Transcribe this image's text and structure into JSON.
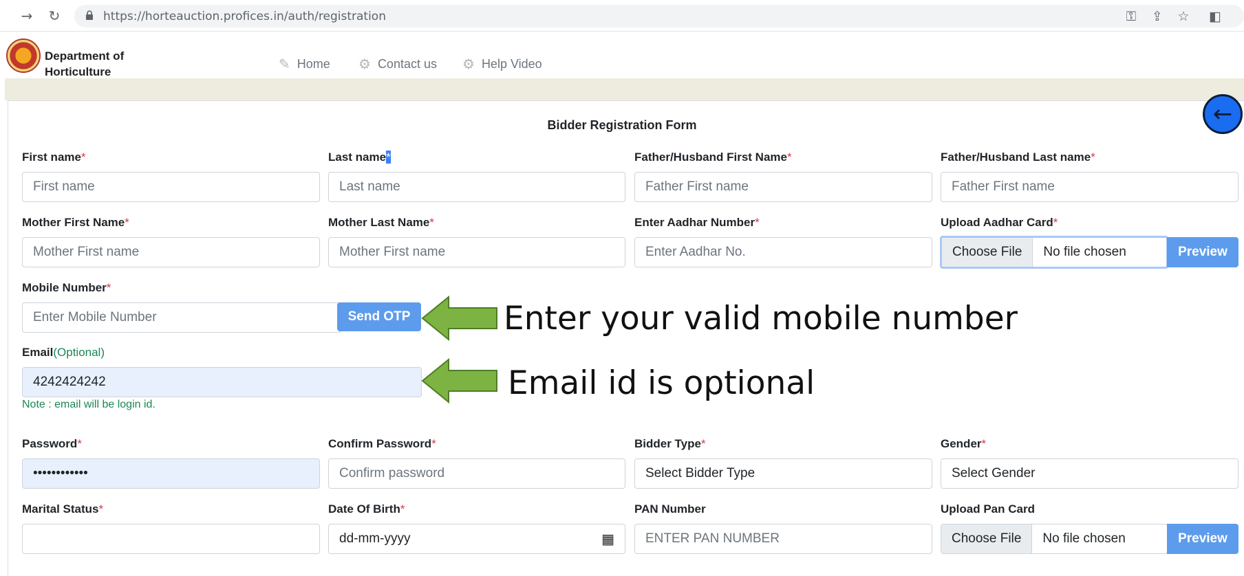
{
  "browser": {
    "url": "https://horteauction.profices.in/auth/registration",
    "icons": [
      "back-arrow",
      "forward-arrow",
      "reload",
      "lock",
      "key",
      "share",
      "star",
      "sidebar"
    ]
  },
  "header": {
    "brand": "Department of Horticulture",
    "nav": [
      {
        "label": "Home",
        "icon": "edit"
      },
      {
        "label": "Contact us",
        "icon": "gear"
      },
      {
        "label": "Help Video",
        "icon": "gear"
      }
    ]
  },
  "form": {
    "title": "Bidder Registration Form",
    "required_mark": "*",
    "first_name": {
      "label": "First name",
      "placeholder": "First name"
    },
    "last_name": {
      "label": "Last name",
      "placeholder": "Last name"
    },
    "father_first": {
      "label": "Father/Husband First Name",
      "placeholder": "Father First name"
    },
    "father_last": {
      "label": "Father/Husband Last name",
      "placeholder": "Father First name"
    },
    "mother_first": {
      "label": "Mother First Name",
      "placeholder": "Mother First name"
    },
    "mother_last": {
      "label": "Mother Last Name",
      "placeholder": "Mother First name"
    },
    "aadhar_no": {
      "label": "Enter Aadhar Number",
      "placeholder": "Enter Aadhar No."
    },
    "aadhar_card": {
      "label": "Upload Aadhar Card",
      "choose": "Choose File",
      "status": "No file chosen",
      "preview": "Preview"
    },
    "mobile": {
      "label": "Mobile Number",
      "placeholder": "Enter Mobile Number",
      "send_otp": "Send OTP"
    },
    "email": {
      "label": "Email",
      "optional": "(Optional)",
      "value": "4242424242",
      "note": "Note : email will be login id."
    },
    "password": {
      "label": "Password",
      "value": "••••••••••••"
    },
    "confirm_password": {
      "label": "Confirm Password",
      "placeholder": "Confirm password"
    },
    "bidder_type": {
      "label": "Bidder Type",
      "selected": "Select Bidder Type"
    },
    "gender": {
      "label": "Gender",
      "selected": "Select Gender"
    },
    "marital_status": {
      "label": "Marital Status",
      "selected": ""
    },
    "dob": {
      "label": "Date Of Birth",
      "placeholder": "dd-mm-yyyy"
    },
    "pan_number": {
      "label": "PAN Number",
      "placeholder": "ENTER PAN NUMBER"
    },
    "pan_card": {
      "label": "Upload Pan Card",
      "choose": "Choose File",
      "status": "No file chosen",
      "preview": "Preview"
    }
  },
  "annotations": {
    "mobile_hint": "Enter your valid mobile number",
    "email_hint": "Email id is optional",
    "arrow_color": "#7cb342"
  }
}
